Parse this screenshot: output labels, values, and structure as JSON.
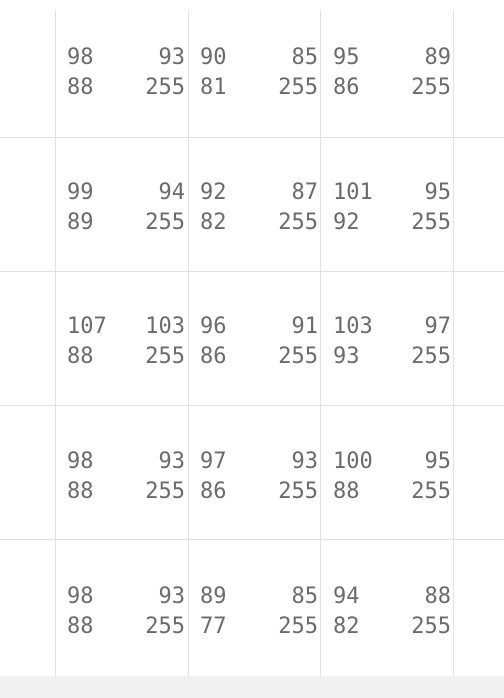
{
  "grid": {
    "rows": [
      [
        {
          "r": "98",
          "g": "93",
          "b": "88",
          "a": "255"
        },
        {
          "r": "90",
          "g": "85",
          "b": "81",
          "a": "255"
        },
        {
          "r": "95",
          "g": "89",
          "b": "86",
          "a": "255"
        }
      ],
      [
        {
          "r": "99",
          "g": "94",
          "b": "89",
          "a": "255"
        },
        {
          "r": "92",
          "g": "87",
          "b": "82",
          "a": "255"
        },
        {
          "r": "101",
          "g": "95",
          "b": "92",
          "a": "255"
        }
      ],
      [
        {
          "r": "107",
          "g": "103",
          "b": "88",
          "a": "255"
        },
        {
          "r": "96",
          "g": "91",
          "b": "86",
          "a": "255"
        },
        {
          "r": "103",
          "g": "97",
          "b": "93",
          "a": "255"
        }
      ],
      [
        {
          "r": "98",
          "g": "93",
          "b": "88",
          "a": "255"
        },
        {
          "r": "97",
          "g": "93",
          "b": "86",
          "a": "255"
        },
        {
          "r": "100",
          "g": "95",
          "b": "88",
          "a": "255"
        }
      ],
      [
        {
          "r": "98",
          "g": "93",
          "b": "88",
          "a": "255"
        },
        {
          "r": "89",
          "g": "85",
          "b": "77",
          "a": "255"
        },
        {
          "r": "94",
          "g": "88",
          "b": "82",
          "a": "255"
        }
      ]
    ]
  }
}
